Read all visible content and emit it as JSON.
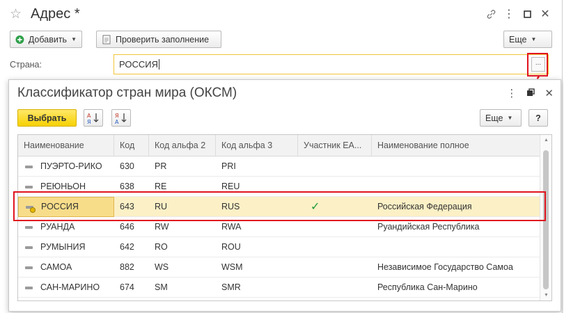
{
  "form": {
    "title": "Адрес *",
    "add_label": "Добавить",
    "check_label": "Проверить заполнение",
    "more_label": "Еще",
    "country_label": "Страна:",
    "country_value": "РОССИЯ",
    "choose_btn": "..."
  },
  "dialog": {
    "title": "Классификатор стран мира (ОКСМ)",
    "select_label": "Выбрать",
    "more_label": "Еще",
    "help_label": "?",
    "columns": [
      "Наименование",
      "Код",
      "Код альфа 2",
      "Код альфа 3",
      "Участник ЕА...",
      "Наименование полное"
    ],
    "rows": [
      {
        "name": "ПУЭРТО-РИКО",
        "code": "630",
        "a2": "PR",
        "a3": "PRI",
        "eaeu": "",
        "full": ""
      },
      {
        "name": "РЕЮНЬОН",
        "code": "638",
        "a2": "RE",
        "a3": "REU",
        "eaeu": "",
        "full": ""
      },
      {
        "name": "РОССИЯ",
        "code": "643",
        "a2": "RU",
        "a3": "RUS",
        "eaeu": "✓",
        "full": "Российская Федерация"
      },
      {
        "name": "РУАНДА",
        "code": "646",
        "a2": "RW",
        "a3": "RWA",
        "eaeu": "",
        "full": "Руандийская Республика"
      },
      {
        "name": "РУМЫНИЯ",
        "code": "642",
        "a2": "RO",
        "a3": "ROU",
        "eaeu": "",
        "full": ""
      },
      {
        "name": "САМОА",
        "code": "882",
        "a2": "WS",
        "a3": "WSM",
        "eaeu": "",
        "full": "Независимое Государство Самоа"
      },
      {
        "name": "САН-МАРИНО",
        "code": "674",
        "a2": "SM",
        "a3": "SMR",
        "eaeu": "",
        "full": "Республика Сан-Марино"
      }
    ],
    "selected_row": 2
  },
  "colors": {
    "accent_yellow": "#f6d100",
    "highlight_red": "#e0141e",
    "check_green": "#1d9a35"
  }
}
